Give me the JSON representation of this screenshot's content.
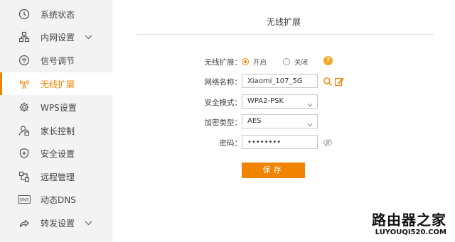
{
  "sidebar": {
    "items": [
      {
        "label": "系统状态",
        "icon": "clock-icon"
      },
      {
        "label": "内网设置",
        "icon": "network-icon",
        "expandable": true
      },
      {
        "label": "信号调节",
        "icon": "signal-icon"
      },
      {
        "label": "无线扩展",
        "icon": "antenna-icon",
        "active": true
      },
      {
        "label": "WPS设置",
        "icon": "gear-icon"
      },
      {
        "label": "家长控制",
        "icon": "user-lock-icon"
      },
      {
        "label": "安全设置",
        "icon": "shield-icon"
      },
      {
        "label": "远程管理",
        "icon": "remote-icon"
      },
      {
        "label": "动态DNS",
        "icon": "dns-icon"
      },
      {
        "label": "转发设置",
        "icon": "share-icon",
        "expandable": true
      }
    ]
  },
  "main": {
    "title": "无线扩展",
    "form": {
      "wireless_extend_label": "无线扩展：",
      "radio_on_label": "开启",
      "radio_off_label": "关闭",
      "radio_selected": "开启",
      "help_glyph": "?",
      "network_name_label": "网络名称：",
      "network_name_value": "Xiaomi_107_5G",
      "security_mode_label": "安全模式：",
      "security_mode_value": "WPA2-PSK",
      "encryption_label": "加密类型：",
      "encryption_value": "AES",
      "password_label": "密码：",
      "password_value": "••••••••",
      "save_label": "保存"
    }
  },
  "watermark": {
    "cn": "路由器之家",
    "en": "LUYOUQI520.COM"
  },
  "colors": {
    "accent": "#f08300",
    "help": "#f5a623",
    "sidebar_bg": "#f3f3f3"
  }
}
